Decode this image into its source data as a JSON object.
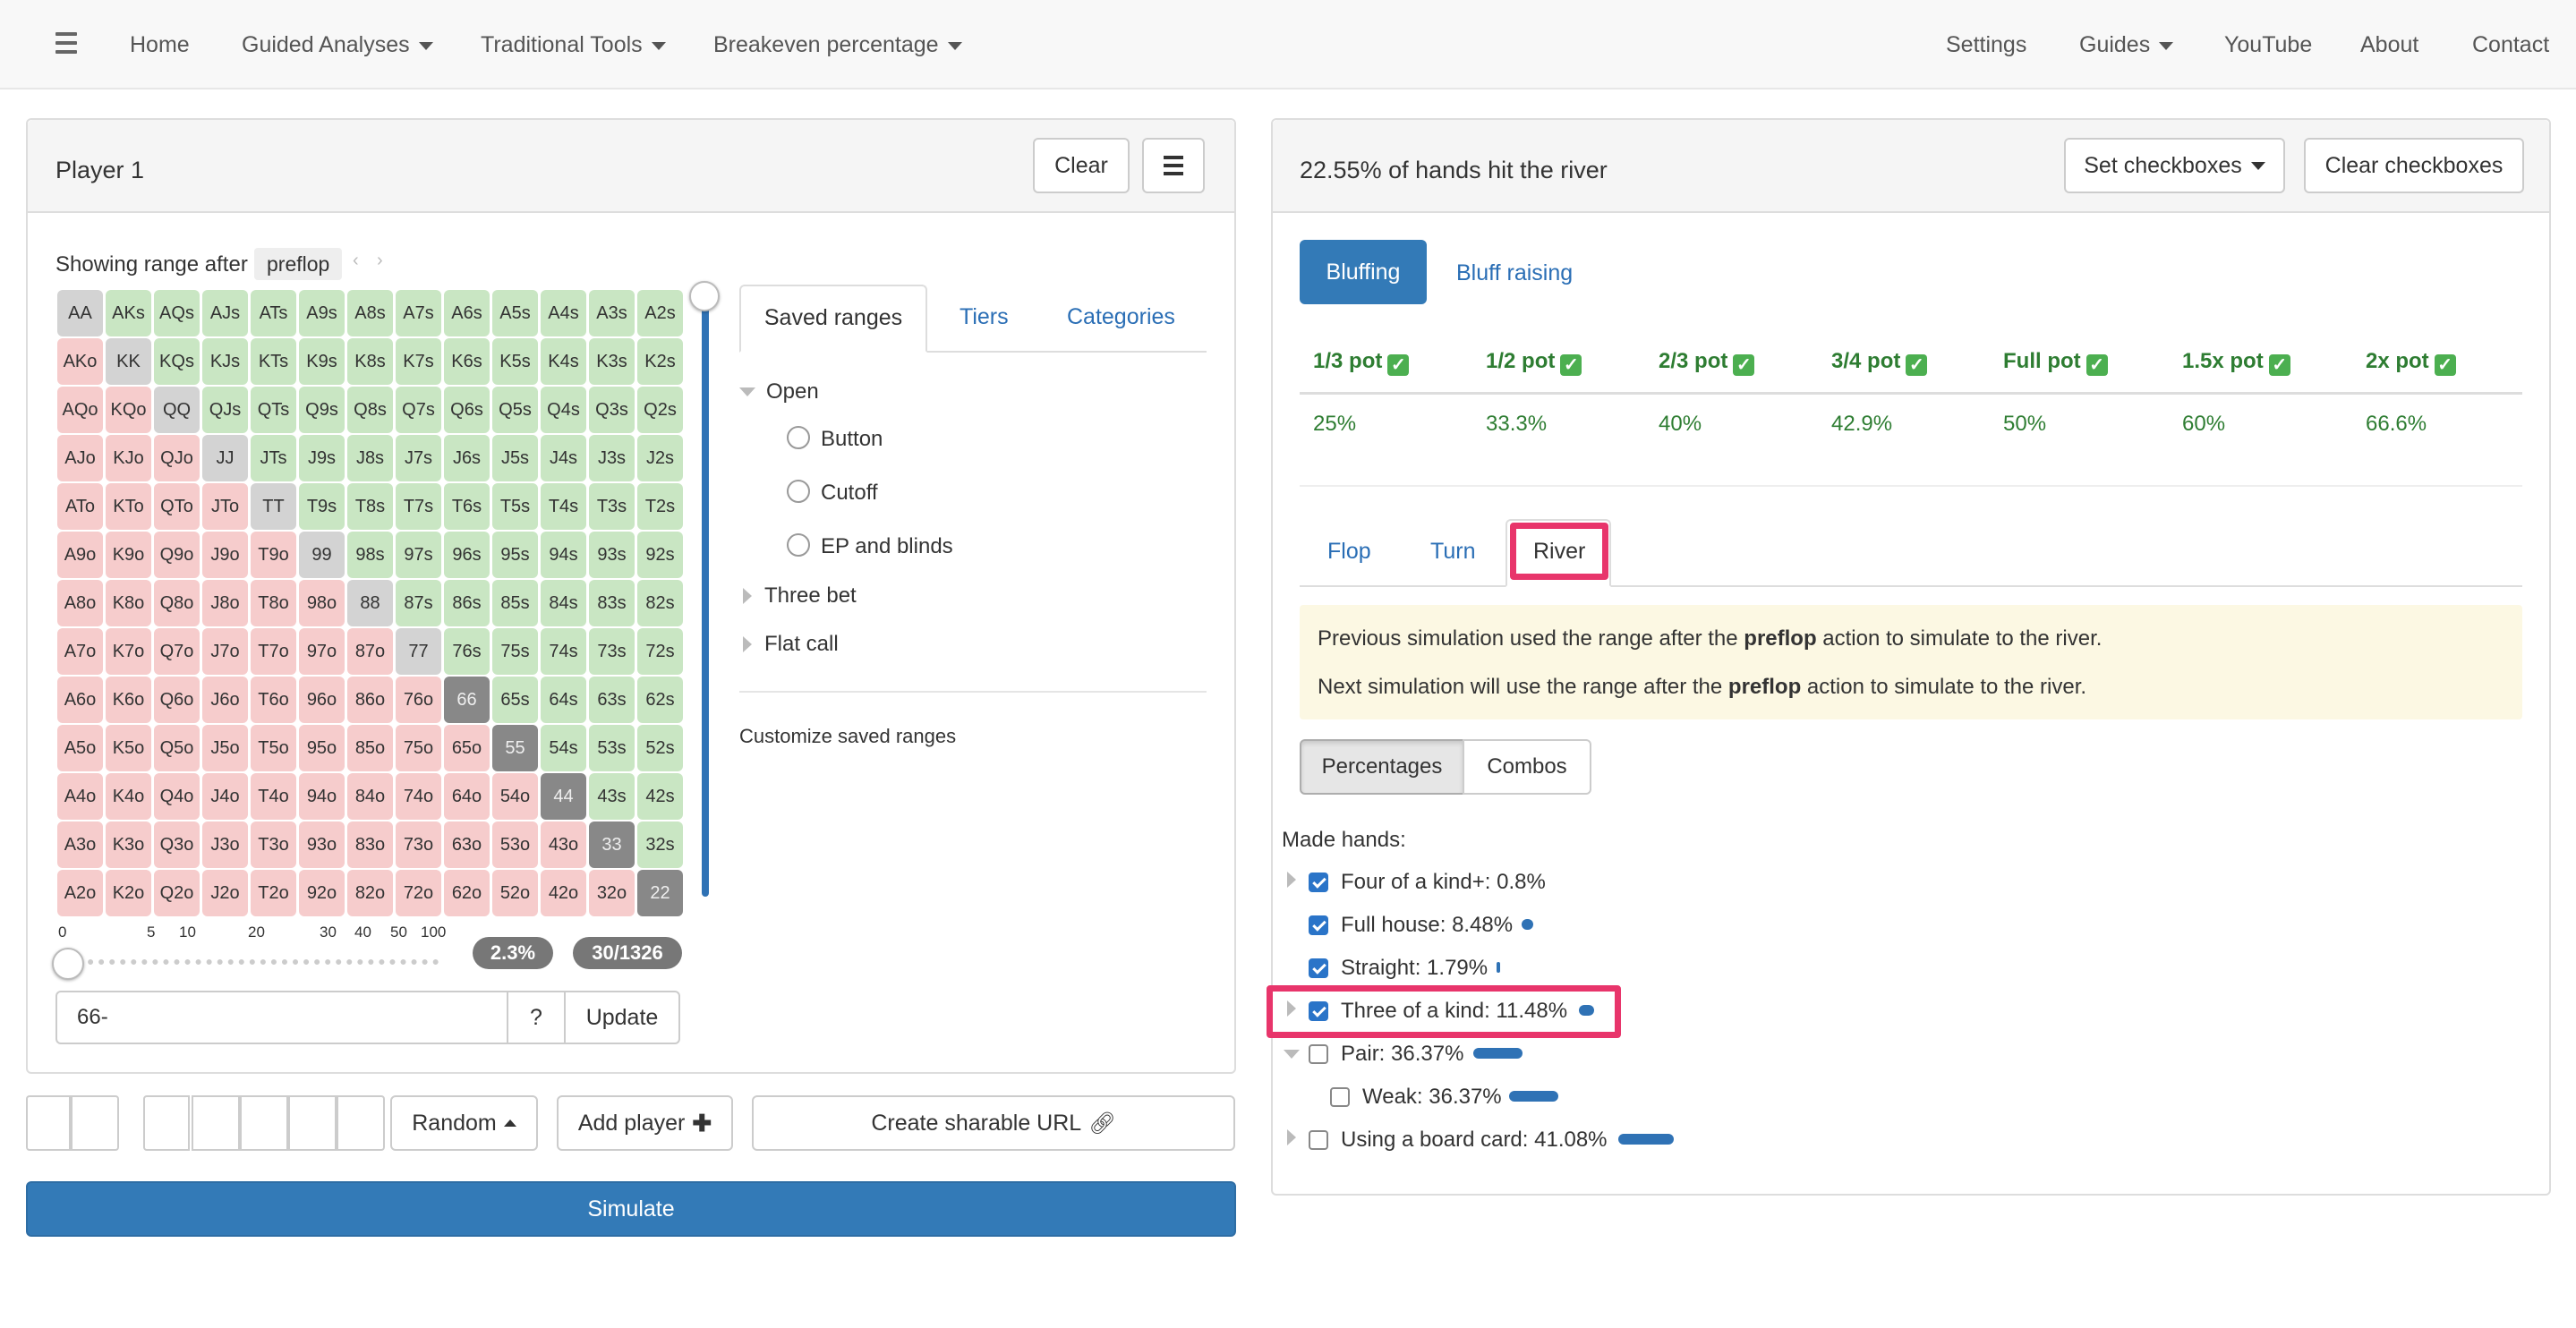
{
  "nav": {
    "home": "Home",
    "guided": "Guided Analyses",
    "traditional": "Traditional Tools",
    "breakeven": "Breakeven percentage",
    "settings": "Settings",
    "guides": "Guides",
    "youtube": "YouTube",
    "about": "About",
    "contact": "Contact"
  },
  "player": {
    "title": "Player 1",
    "clear": "Clear",
    "showing_label": "Showing range after",
    "street": "preflop",
    "range_input": "66-",
    "help": "?",
    "update": "Update",
    "percent_badge": "2.3%",
    "combos_badge": "30/1326",
    "slider_ticks": [
      "0",
      "5",
      "10",
      "20",
      "30",
      "40",
      "50",
      "100"
    ]
  },
  "hand_grid": [
    [
      "AA",
      "AKs",
      "AQs",
      "AJs",
      "ATs",
      "A9s",
      "A8s",
      "A7s",
      "A6s",
      "A5s",
      "A4s",
      "A3s",
      "A2s"
    ],
    [
      "AKo",
      "KK",
      "KQs",
      "KJs",
      "KTs",
      "K9s",
      "K8s",
      "K7s",
      "K6s",
      "K5s",
      "K4s",
      "K3s",
      "K2s"
    ],
    [
      "AQo",
      "KQo",
      "QQ",
      "QJs",
      "QTs",
      "Q9s",
      "Q8s",
      "Q7s",
      "Q6s",
      "Q5s",
      "Q4s",
      "Q3s",
      "Q2s"
    ],
    [
      "AJo",
      "KJo",
      "QJo",
      "JJ",
      "JTs",
      "J9s",
      "J8s",
      "J7s",
      "J6s",
      "J5s",
      "J4s",
      "J3s",
      "J2s"
    ],
    [
      "ATo",
      "KTo",
      "QTo",
      "JTo",
      "TT",
      "T9s",
      "T8s",
      "T7s",
      "T6s",
      "T5s",
      "T4s",
      "T3s",
      "T2s"
    ],
    [
      "A9o",
      "K9o",
      "Q9o",
      "J9o",
      "T9o",
      "99",
      "98s",
      "97s",
      "96s",
      "95s",
      "94s",
      "93s",
      "92s"
    ],
    [
      "A8o",
      "K8o",
      "Q8o",
      "J8o",
      "T8o",
      "98o",
      "88",
      "87s",
      "86s",
      "85s",
      "84s",
      "83s",
      "82s"
    ],
    [
      "A7o",
      "K7o",
      "Q7o",
      "J7o",
      "T7o",
      "97o",
      "87o",
      "77",
      "76s",
      "75s",
      "74s",
      "73s",
      "72s"
    ],
    [
      "A6o",
      "K6o",
      "Q6o",
      "J6o",
      "T6o",
      "96o",
      "86o",
      "76o",
      "66",
      "65s",
      "64s",
      "63s",
      "62s"
    ],
    [
      "A5o",
      "K5o",
      "Q5o",
      "J5o",
      "T5o",
      "95o",
      "85o",
      "75o",
      "65o",
      "55",
      "54s",
      "53s",
      "52s"
    ],
    [
      "A4o",
      "K4o",
      "Q4o",
      "J4o",
      "T4o",
      "94o",
      "84o",
      "74o",
      "64o",
      "54o",
      "44",
      "43s",
      "42s"
    ],
    [
      "A3o",
      "K3o",
      "Q3o",
      "J3o",
      "T3o",
      "93o",
      "83o",
      "73o",
      "63o",
      "53o",
      "43o",
      "33",
      "32s"
    ],
    [
      "A2o",
      "K2o",
      "Q2o",
      "J2o",
      "T2o",
      "92o",
      "82o",
      "72o",
      "62o",
      "52o",
      "42o",
      "32o",
      "22"
    ]
  ],
  "selected_pairs": [
    "66",
    "55",
    "44",
    "33",
    "22"
  ],
  "saved": {
    "tabs": [
      "Saved ranges",
      "Tiers",
      "Categories"
    ],
    "open": "Open",
    "button": "Button",
    "cutoff": "Cutoff",
    "ep": "EP and blinds",
    "three_bet": "Three bet",
    "flat_call": "Flat call",
    "customize": "Customize saved ranges"
  },
  "bottom": {
    "random": "Random",
    "add_player": "Add player",
    "share": "Create sharable URL",
    "simulate": "Simulate"
  },
  "results": {
    "title": "22.55% of hands hit the river",
    "set_checkboxes": "Set checkboxes",
    "clear_checkboxes": "Clear checkboxes",
    "pill_bluffing": "Bluffing",
    "pill_bluff_raising": "Bluff raising",
    "pot_headers": [
      "1/3 pot",
      "1/2 pot",
      "2/3 pot",
      "3/4 pot",
      "Full pot",
      "1.5x pot",
      "2x pot"
    ],
    "pot_values": [
      "25%",
      "33.3%",
      "40%",
      "42.9%",
      "50%",
      "60%",
      "66.6%"
    ],
    "street_tabs": [
      "Flop",
      "Turn",
      "River"
    ],
    "info_prev_a": "Previous simulation used the range after the ",
    "info_prev_b": "preflop",
    "info_prev_c": " action to simulate to the river.",
    "info_next_a": "Next simulation will use the range after the ",
    "info_next_b": "preflop",
    "info_next_c": " action to simulate to the river.",
    "toggle_percent": "Percentages",
    "toggle_combos": "Combos",
    "made_hands": "Made hands:",
    "rows": [
      {
        "label": "Four of a kind+: 0.8%",
        "checked": true,
        "share": 0.008
      },
      {
        "label": "Full house: 8.48%",
        "checked": true,
        "share": 0.0848
      },
      {
        "label": "Straight: 1.79%",
        "checked": true,
        "share": 0.0179
      },
      {
        "label": "Three of a kind: 11.48%",
        "checked": true,
        "share": 0.1148
      },
      {
        "label": "Pair: 36.37%",
        "checked": false,
        "share": 0.3637
      },
      {
        "label": "Weak: 36.37%",
        "checked": false,
        "share": 0.3637
      },
      {
        "label": "Using a board card: 41.08%",
        "checked": false,
        "share": 0.4108
      }
    ]
  },
  "colors": {
    "accent": "#2f72b5",
    "highlight": "#e8356b",
    "suited": "#c9e6c3",
    "offsuit": "#f6cccc",
    "pair": "#d3d3d3",
    "selected": "#888888",
    "info_bg": "#fcf8e3"
  }
}
